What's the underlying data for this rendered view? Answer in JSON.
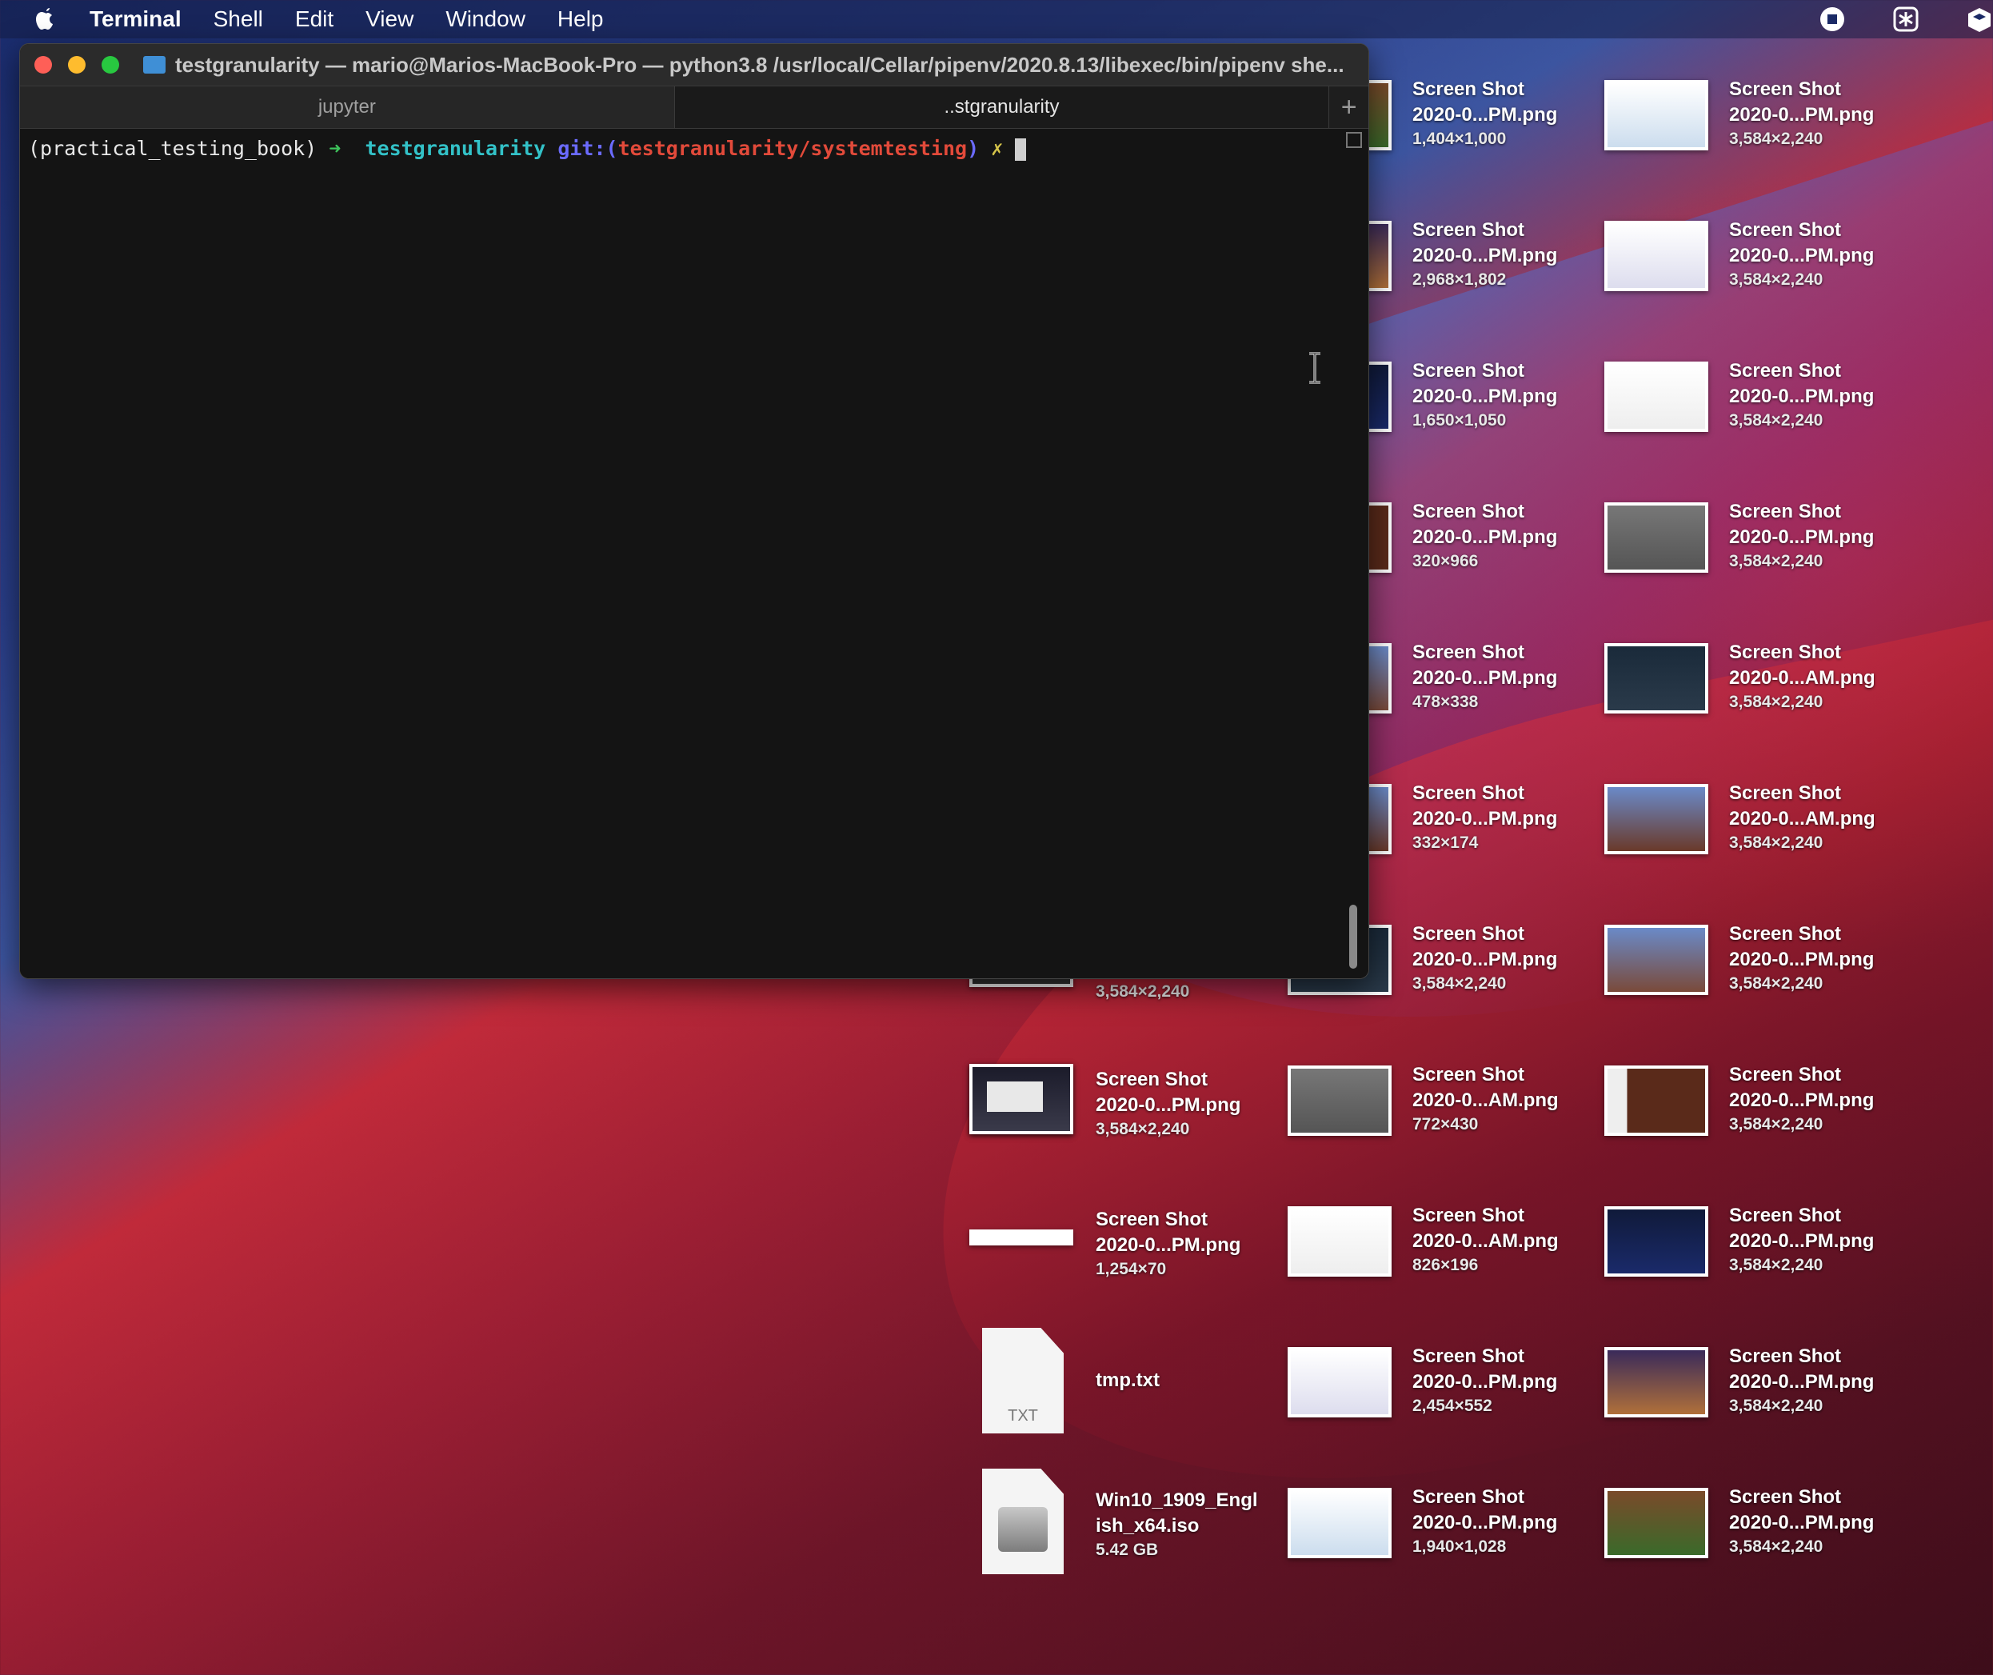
{
  "menubar": {
    "app_name": "Terminal",
    "items": [
      "Shell",
      "Edit",
      "View",
      "Window",
      "Help"
    ],
    "right_icons": [
      "stop-record-icon",
      "settings-asterisk-icon",
      "cube-icon"
    ]
  },
  "terminal": {
    "title": "testgranularity — mario@Marios-MacBook-Pro — python3.8 /usr/local/Cellar/pipenv/2020.8.13/libexec/bin/pipenv she...",
    "tabs": [
      {
        "label": "jupyter",
        "active": false
      },
      {
        "label": "..stgranularity",
        "active": true
      }
    ],
    "add_tab_label": "+",
    "prompt": {
      "env": "(practical_testing_book)",
      "arrow": "➜",
      "dir": "testgranularity",
      "git_prefix": "git:(",
      "branch": "testgranularity/systemtesting",
      "git_suffix": ")",
      "dirty": "✗"
    }
  },
  "desktop": {
    "col0": [
      {
        "name": "",
        "dims": "3,584×2,240"
      },
      {
        "line1": "Screen Shot",
        "line2": "2020-0...PM.png",
        "dims": "3,584×2,240"
      },
      {
        "line1": "Screen Shot",
        "line2": "2020-0...PM.png",
        "dims": "1,254×70"
      },
      {
        "line1": "tmp.txt",
        "badge": "TXT"
      },
      {
        "line1": "Win10_1909_Engl",
        "line2": "ish_x64.iso",
        "dims": "5.42 GB"
      }
    ],
    "col1": [
      {
        "line1": "Screen Shot",
        "line2": "2020-0...PM.png",
        "dims": "1,404×1,000"
      },
      {
        "line1": "Screen Shot",
        "line2": "2020-0...PM.png",
        "dims": "2,968×1,802"
      },
      {
        "line1": "Screen Shot",
        "line2": "2020-0...PM.png",
        "dims": "1,650×1,050"
      },
      {
        "line1": "Screen Shot",
        "line2": "2020-0...PM.png",
        "dims": "320×966"
      },
      {
        "line1": "Screen Shot",
        "line2": "2020-0...PM.png",
        "dims": "478×338"
      },
      {
        "line1": "Screen Shot",
        "line2": "2020-0...PM.png",
        "dims": "332×174"
      },
      {
        "line1": "Screen Shot",
        "line2": "2020-0...PM.png",
        "dims": "3,584×2,240"
      },
      {
        "line1": "Screen Shot",
        "line2": "2020-0...AM.png",
        "dims": "772×430"
      },
      {
        "line1": "Screen Shot",
        "line2": "2020-0...AM.png",
        "dims": "826×196"
      },
      {
        "line1": "Screen Shot",
        "line2": "2020-0...PM.png",
        "dims": "2,454×552"
      },
      {
        "line1": "Screen Shot",
        "line2": "2020-0...PM.png",
        "dims": "1,940×1,028"
      }
    ],
    "col2": [
      {
        "line1": "Screen Shot",
        "line2": "2020-0...PM.png",
        "dims": "3,584×2,240"
      },
      {
        "line1": "Screen Shot",
        "line2": "2020-0...PM.png",
        "dims": "3,584×2,240"
      },
      {
        "line1": "Screen Shot",
        "line2": "2020-0...PM.png",
        "dims": "3,584×2,240"
      },
      {
        "line1": "Screen Shot",
        "line2": "2020-0...PM.png",
        "dims": "3,584×2,240"
      },
      {
        "line1": "Screen Shot",
        "line2": "2020-0...AM.png",
        "dims": "3,584×2,240"
      },
      {
        "line1": "Screen Shot",
        "line2": "2020-0...AM.png",
        "dims": "3,584×2,240"
      },
      {
        "line1": "Screen Shot",
        "line2": "2020-0...PM.png",
        "dims": "3,584×2,240"
      },
      {
        "line1": "Screen Shot",
        "line2": "2020-0...PM.png",
        "dims": "3,584×2,240"
      },
      {
        "line1": "Screen Shot",
        "line2": "2020-0...PM.png",
        "dims": "3,584×2,240"
      },
      {
        "line1": "Screen Shot",
        "line2": "2020-0...PM.png",
        "dims": "3,584×2,240"
      },
      {
        "line1": "Screen Shot",
        "line2": "2020-0...PM.png",
        "dims": "3,584×2,240"
      }
    ]
  }
}
